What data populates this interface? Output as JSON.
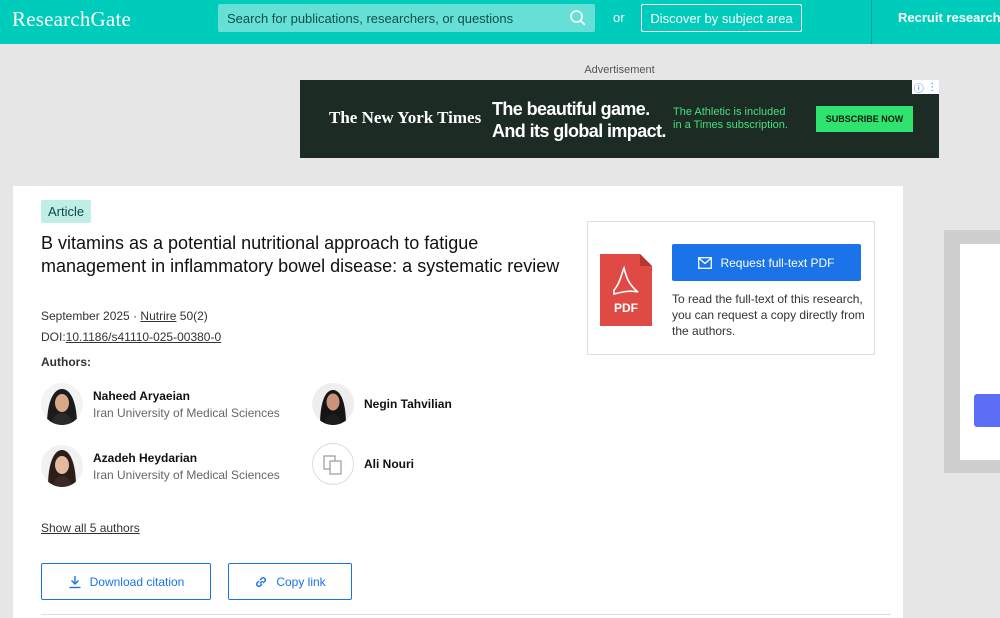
{
  "header": {
    "brand": "ResearchGate",
    "search_placeholder": "Search for publications, researchers, or questions",
    "or_label": "or",
    "discover_label": "Discover by subject area",
    "recruit_label": "Recruit researchers"
  },
  "ad": {
    "label": "Advertisement",
    "brand": "The New York Times",
    "headline_line1": "The beautiful game.",
    "headline_line2": "And its global impact.",
    "sub_line1": "The Athletic is included",
    "sub_line2": "in a Times subscription.",
    "cta": "SUBSCRIBE NOW"
  },
  "article": {
    "type_badge": "Article",
    "title": "B vitamins as a potential nutritional approach to fatigue management in inflammatory bowel disease: a systematic review",
    "date": "September 2025",
    "separator": " · ",
    "journal": "Nutrire",
    "volume": "50(2)",
    "doi_label": "DOI:",
    "doi": "10.1186/s41110-025-00380-0",
    "authors_heading": "Authors:",
    "authors": [
      {
        "name": "Naheed Aryaeian",
        "institution": "Iran University of Medical Sciences"
      },
      {
        "name": "Negin Tahvilian",
        "institution": ""
      },
      {
        "name": "Azadeh Heydarian",
        "institution": "Iran University of Medical Sciences"
      },
      {
        "name": "Ali Nouri",
        "institution": ""
      }
    ],
    "show_all": "Show all 5 authors",
    "download_citation": "Download citation",
    "copy_link": "Copy link"
  },
  "fulltext": {
    "request_label": "Request full-text PDF",
    "description": "To read the full-text of this research, you can request a copy directly from the authors.",
    "pdf_icon_text": "PDF"
  },
  "colors": {
    "brand": "#00ccbb",
    "accent": "#1a73e8",
    "badge_bg": "#bfeee7",
    "pdf_red": "#e04a45"
  }
}
